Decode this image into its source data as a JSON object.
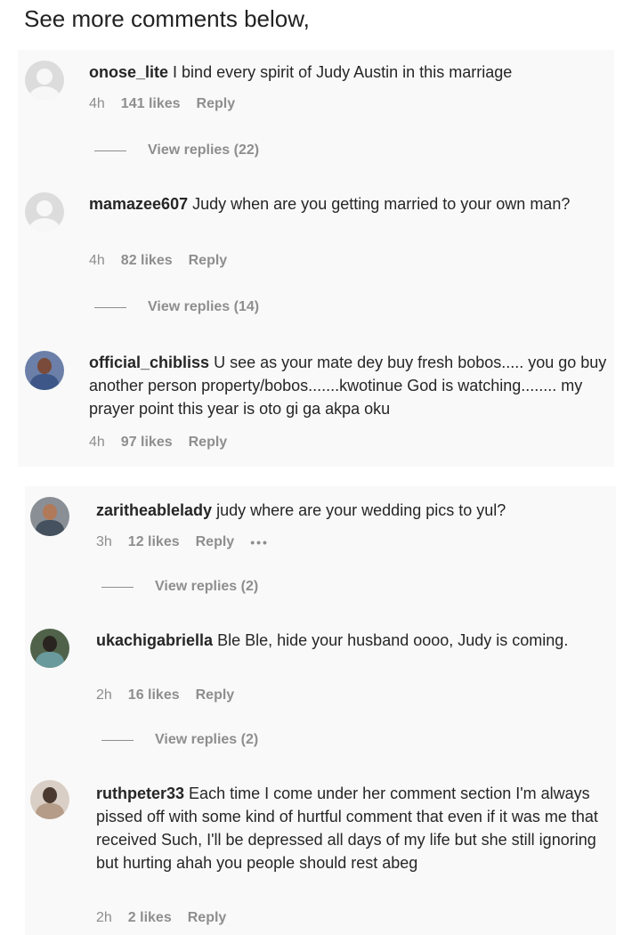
{
  "heading": "See more comments below,",
  "comments": [
    {
      "username": "onose_lite",
      "text": "I bind every spirit of Judy Austin in this marriage",
      "time": "4h",
      "likes": "141 likes",
      "reply": "Reply",
      "view_replies": "View replies (22)",
      "avatar": "default-avatar-icon"
    },
    {
      "username": "mamazee607",
      "text": "Judy when are you getting married to your own man?",
      "time": "4h",
      "likes": "82 likes",
      "reply": "Reply",
      "view_replies": "View replies (14)",
      "avatar": "default-avatar-icon"
    },
    {
      "username": "official_chibliss",
      "text": "U see as your mate dey buy fresh bobos..... you go buy another person property/bobos.......kwotinue God is watching........ my prayer point this year is oto gi ga akpa oku",
      "time": "4h",
      "likes": "97 likes",
      "reply": "Reply",
      "avatar": "profile-photo-icon"
    },
    {
      "username": "zaritheablelady",
      "text": "judy where are your wedding pics to yul?",
      "time": "3h",
      "likes": "12 likes",
      "reply": "Reply",
      "more": "•••",
      "view_replies": "View replies (2)",
      "avatar": "profile-photo-icon"
    },
    {
      "username": "ukachigabriella",
      "text": "Ble Ble, hide your husband oooo, Judy is coming.",
      "time": "2h",
      "likes": "16 likes",
      "reply": "Reply",
      "view_replies": "View replies (2)",
      "avatar": "profile-photo-icon"
    },
    {
      "username": "ruthpeter33",
      "text": "Each time I come under her comment section I'm always pissed off with some kind of hurtful comment that even if it was me that received Such, I'll be depressed all days of my life but she still ignoring but hurting ahah you people should rest abeg",
      "time": "2h",
      "likes": "2 likes",
      "reply": "Reply",
      "avatar": "profile-photo-icon"
    }
  ]
}
